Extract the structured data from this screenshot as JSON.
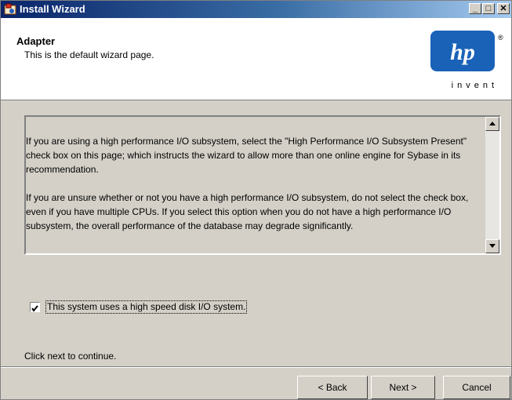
{
  "window": {
    "title": "Install Wizard",
    "controls": {
      "minimize": "_",
      "maximize": "□",
      "close": "✕"
    }
  },
  "header": {
    "title": "Adapter",
    "subtitle": "This is the default wizard page.",
    "logo_text": "invent",
    "logo_reg": "®"
  },
  "info": {
    "paragraphs": [
      "If you are using a high performance I/O subsystem, select the \"High Performance I/O Subsystem Present\" check box on this page; which instructs the wizard to allow more than one online engine for Sybase in its recommendation.",
      "If you are unsure whether or not you have a high performance I/O subsystem, do not select the check box, even if you have multiple CPUs.  If you select this option when you do not have a high performance I/O subsystem, the overall performance of the database may degrade significantly."
    ]
  },
  "option": {
    "label": "This system uses a high speed disk I/O system.",
    "checked": true
  },
  "footer": {
    "hint": "Click next to continue.",
    "back_label": "< Back",
    "next_label": "Next >",
    "cancel_label": "Cancel"
  },
  "colors": {
    "title_start": "#0a246a",
    "title_end": "#a6caf0",
    "face": "#d4d0c8",
    "hp_blue": "#1a62b8"
  }
}
